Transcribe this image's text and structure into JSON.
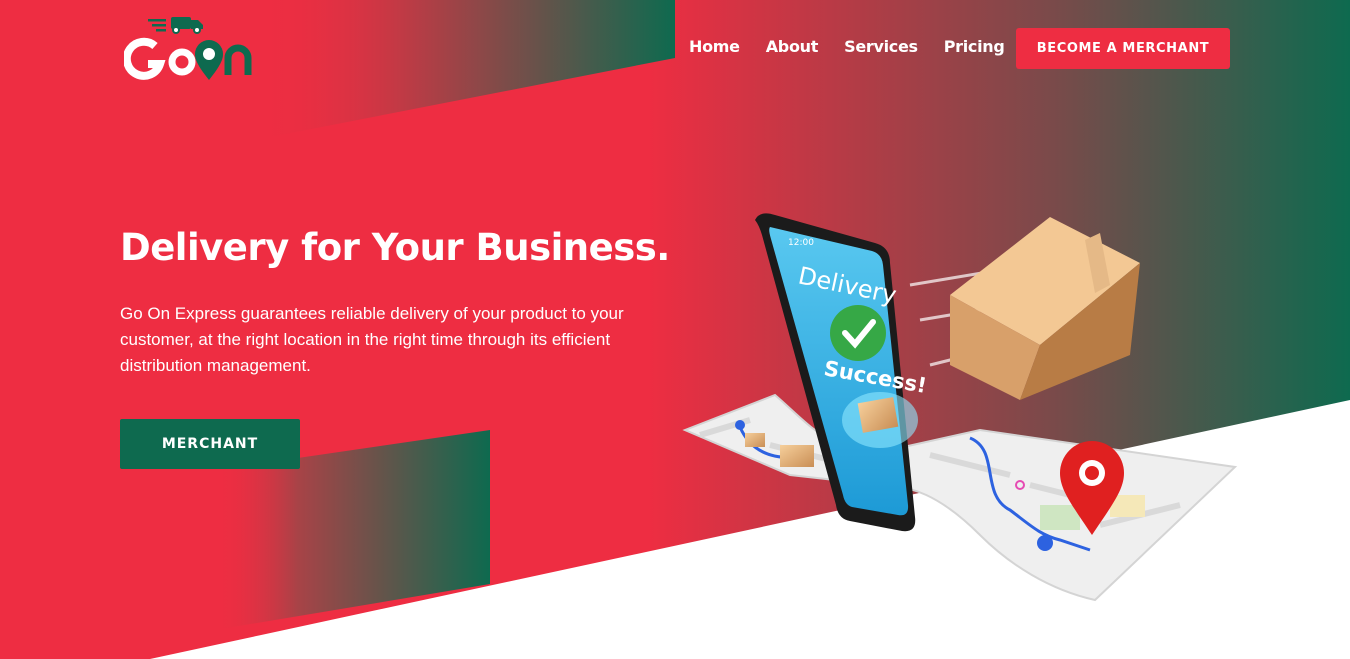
{
  "brand": {
    "logo_text": "GoOn"
  },
  "nav": {
    "items": [
      {
        "label": "Home"
      },
      {
        "label": "About"
      },
      {
        "label": "Services"
      },
      {
        "label": "Pricing"
      }
    ],
    "cta_label": "BECOME A MERCHANT"
  },
  "hero": {
    "title": "Delivery for Your Business.",
    "description": "Go On Express guarantees reliable delivery of your product to your customer, at the right location in the right time through its efficient distribution management.",
    "button_label": "MERCHANT"
  },
  "illustration": {
    "phone_time": "12:00",
    "screen_title": "Delivery",
    "screen_status": "Success!"
  },
  "colors": {
    "primary_red": "#ee2d42",
    "brand_green": "#0e6a4f",
    "white": "#ffffff"
  }
}
